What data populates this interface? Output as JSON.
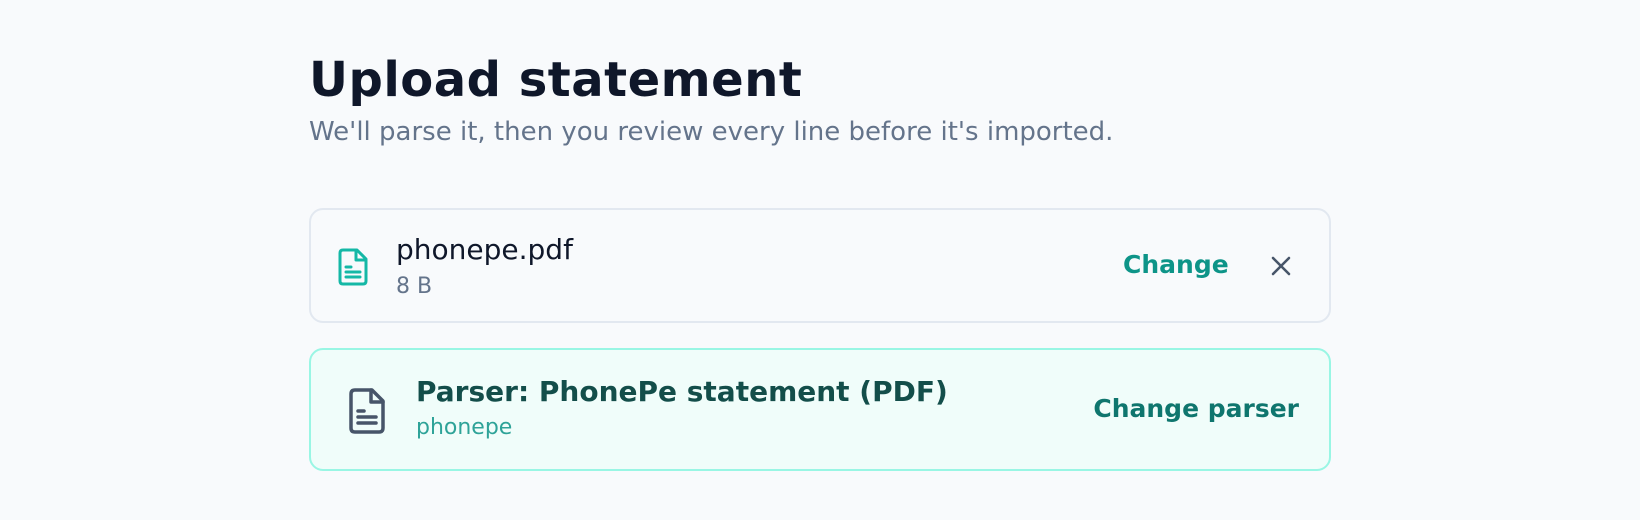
{
  "header": {
    "title": "Upload statement",
    "subtitle": "We'll parse it, then you review every line before it's imported."
  },
  "file": {
    "icon": "file-text-icon",
    "name": "phonepe.pdf",
    "size": "8 B",
    "change_label": "Change",
    "remove_icon": "close-icon"
  },
  "parser": {
    "icon": "file-text-icon",
    "title": "Parser: PhonePe statement (PDF)",
    "id": "phonepe",
    "change_label": "Change parser"
  },
  "colors": {
    "accent": "#0d9488",
    "accent_dark": "#134e4a",
    "parser_bg": "#f0fdfa",
    "parser_border": "#99f6e4"
  }
}
